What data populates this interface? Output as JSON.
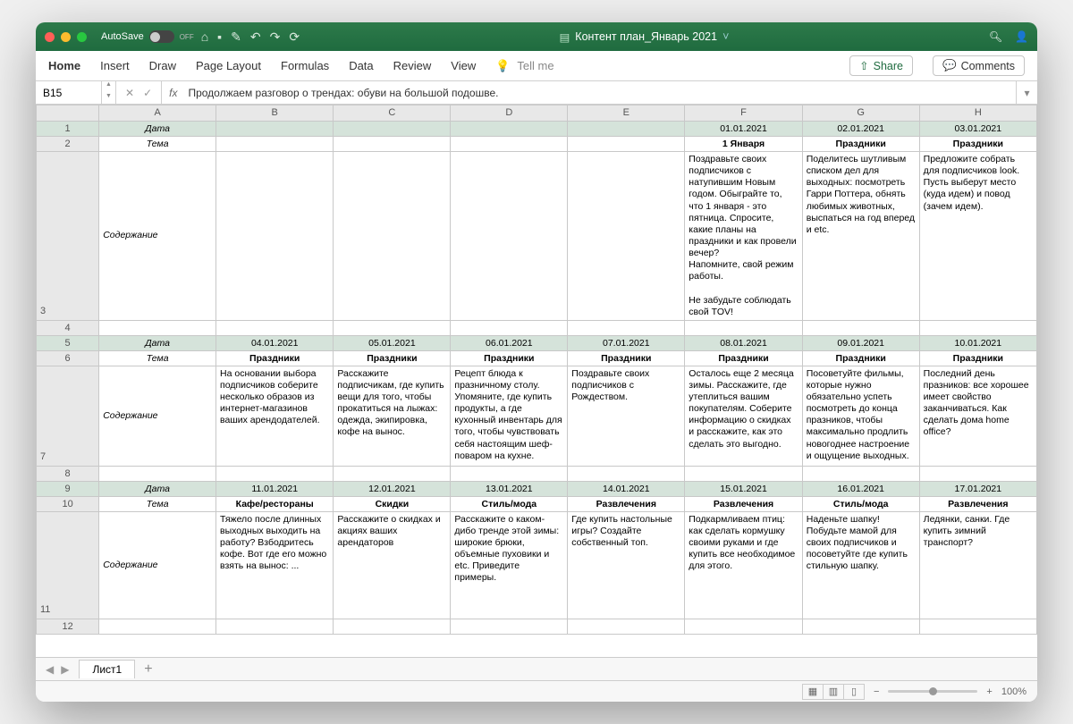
{
  "title": "Контент план_Январь 2021",
  "autosave": "AutoSave",
  "autosave_state": "OFF",
  "ribbon": {
    "tabs": [
      "Home",
      "Insert",
      "Draw",
      "Page Layout",
      "Formulas",
      "Data",
      "Review",
      "View"
    ],
    "tellme": "Tell me",
    "share": "Share",
    "comments": "Comments"
  },
  "namebox": "B15",
  "fx": "fx",
  "formula": "Продолжаем разговор о трендах: обуви на большой подошве.",
  "cols": [
    "A",
    "B",
    "C",
    "D",
    "E",
    "F",
    "G",
    "H"
  ],
  "labels": {
    "date": "Дата",
    "tema": "Тема",
    "content": "Содержание"
  },
  "block1": {
    "dates": [
      "",
      "",
      "",
      "",
      "01.01.2021",
      "02.01.2021",
      "03.01.2021"
    ],
    "temas": [
      "",
      "",
      "",
      "",
      "1 Января",
      "Праздники",
      "Праздники"
    ],
    "content": [
      "",
      "",
      "",
      "",
      "Поздравьте своих подписчиков с натупившим Новым годом. Обыграйте то, что 1 января - это пятница. Спросите, какие планы на праздники и как провели вечер?\nНапомните, свой режим работы.\n\nНе забудьте соблюдать свой TOV!",
      "Поделитесь шутливым списком дел для выходных: посмотреть Гарри Поттера, обнять любимых животных, выспаться на год вперед и etc.",
      "Предложите собрать для подписчиков look. Пусть выберут место (куда идем) и повод (зачем идем)."
    ]
  },
  "block2": {
    "dates": [
      "04.01.2021",
      "05.01.2021",
      "06.01.2021",
      "07.01.2021",
      "08.01.2021",
      "09.01.2021",
      "10.01.2021"
    ],
    "temas": [
      "Праздники",
      "Праздники",
      "Праздники",
      "Праздники",
      "Праздники",
      "Праздники",
      "Праздники"
    ],
    "content": [
      "На основании выбора подписчиков соберите несколько образов из интернет-магазинов ваших арендодателей.",
      "Расскажите подписчикам, где купить вещи для того, чтобы прокатиться на лыжах: одежда, экипировка, кофе на вынос.",
      "Рецепт блюда к празничному столу. Упомяните, где купить продукты, а где кухонный инвентарь для того, чтобы чувствовать себя настоящим шеф-поваром на кухне.",
      "Поздравьте своих подписчиков с Рождеством.",
      "Осталось еще 2 месяца зимы. Расскажите, где утеплиться вашим покупателям. Соберите информацию о скидках и расскажите, как это сделать это выгодно.",
      "Посоветуйте фильмы, которые нужно обязательно успеть посмотреть до конца празников, чтобы максимально продлить новогоднее настроение и ощущение выходных.",
      "Последний день празников: все хорошее имеет свойство заканчиваться. Как сделать дома home office?"
    ]
  },
  "block3": {
    "dates": [
      "11.01.2021",
      "12.01.2021",
      "13.01.2021",
      "14.01.2021",
      "15.01.2021",
      "16.01.2021",
      "17.01.2021"
    ],
    "temas": [
      "Кафе/рестораны",
      "Скидки",
      "Стиль/мода",
      "Развлечения",
      "Развлечения",
      "Стиль/мода",
      "Развлечения"
    ],
    "content": [
      "Тяжело после длинных выходных выходить на работу? Взбодритесь кофе. Вот где его можно взять на вынос:  ...",
      "Расскажите о скидках и акциях ваших арендаторов",
      "Расскажите о каком-дибо тренде этой зимы: широкие брюки, объемные пуховики и etc. Приведите примеры.",
      "Где купить настольные игры? Создайте собственный топ.",
      "Подкармливаем птиц: как сделать кормушку своими руками и где купить все необходимое для этого.",
      "Наденьте шапку! Побудьте мамой для своих подписчиков и посоветуйте где купить стильную шапку.",
      "Ледянки, санки. Где купить зимний транспорт?"
    ]
  },
  "sheet": "Лист1",
  "zoom": "100%"
}
